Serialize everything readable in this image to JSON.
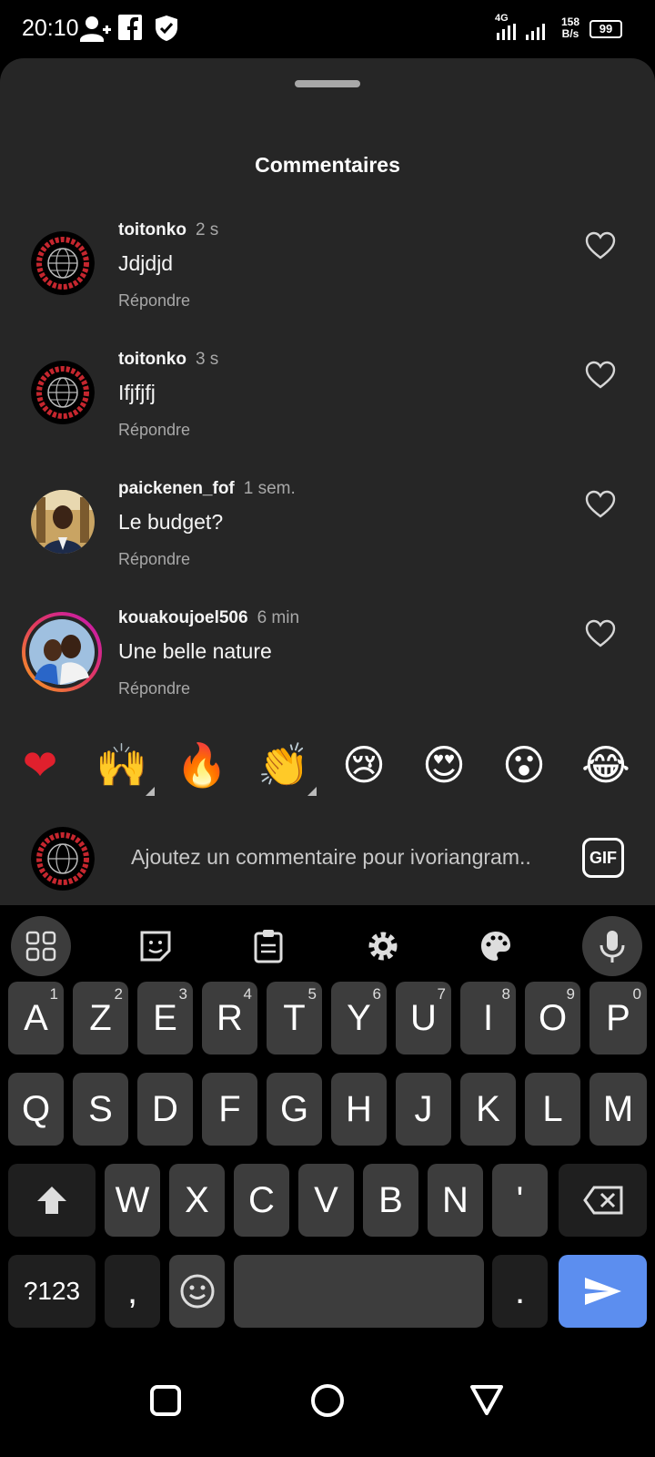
{
  "status_bar": {
    "time": "20:10",
    "network": "4G",
    "speed": "158\nB/s",
    "speed_value": "158",
    "speed_unit": "B/s",
    "battery": "99",
    "icons": [
      "person-add-icon",
      "facebook-icon",
      "shield-check-icon",
      "signal-icon",
      "battery-icon"
    ]
  },
  "sheet": {
    "title": "Commentaires"
  },
  "comments": [
    {
      "user": "toitonko",
      "time": "2 s",
      "text": "Jdjdjd",
      "reply": "Répondre",
      "avatar": "logo"
    },
    {
      "user": "toitonko",
      "time": "3 s",
      "text": "Ifjfjfj",
      "reply": "Répondre",
      "avatar": "logo"
    },
    {
      "user": "paickenen_fof",
      "time": "1 sem.",
      "text": "Le budget?",
      "reply": "Répondre",
      "avatar": "photo"
    },
    {
      "user": "kouakoujoel506",
      "time": "6 min",
      "text": "Une belle nature",
      "reply": "Répondre",
      "avatar": "photo-story"
    }
  ],
  "emojis": [
    "❤",
    "🙌",
    "🔥",
    "👏",
    "😢",
    "😍",
    "😮",
    "😂"
  ],
  "input": {
    "placeholder": "Ajoutez un commentaire pour ivoriangram..",
    "gif_label": "GIF"
  },
  "keyboard": {
    "row1": [
      {
        "l": "A",
        "n": "1"
      },
      {
        "l": "Z",
        "n": "2"
      },
      {
        "l": "E",
        "n": "3"
      },
      {
        "l": "R",
        "n": "4"
      },
      {
        "l": "T",
        "n": "5"
      },
      {
        "l": "Y",
        "n": "6"
      },
      {
        "l": "U",
        "n": "7"
      },
      {
        "l": "I",
        "n": "8"
      },
      {
        "l": "O",
        "n": "9"
      },
      {
        "l": "P",
        "n": "0"
      }
    ],
    "row2": [
      "Q",
      "S",
      "D",
      "F",
      "G",
      "H",
      "J",
      "K",
      "L",
      "M"
    ],
    "row3": [
      "W",
      "X",
      "C",
      "V",
      "B",
      "N",
      "'"
    ],
    "symbols_label": "?123",
    "comma": ",",
    "period": ".",
    "toolbar_icons": [
      "apps-grid-icon",
      "sticker-icon",
      "clipboard-icon",
      "settings-icon",
      "palette-icon",
      "microphone-icon"
    ]
  },
  "nav": {
    "icons": [
      "recents-square-icon",
      "home-circle-icon",
      "back-triangle-icon"
    ]
  },
  "colors": {
    "sheet_bg": "#262626",
    "key_bg": "#3d3d3d",
    "send_key": "#5c8eef",
    "heart_red": "#e0202d"
  }
}
